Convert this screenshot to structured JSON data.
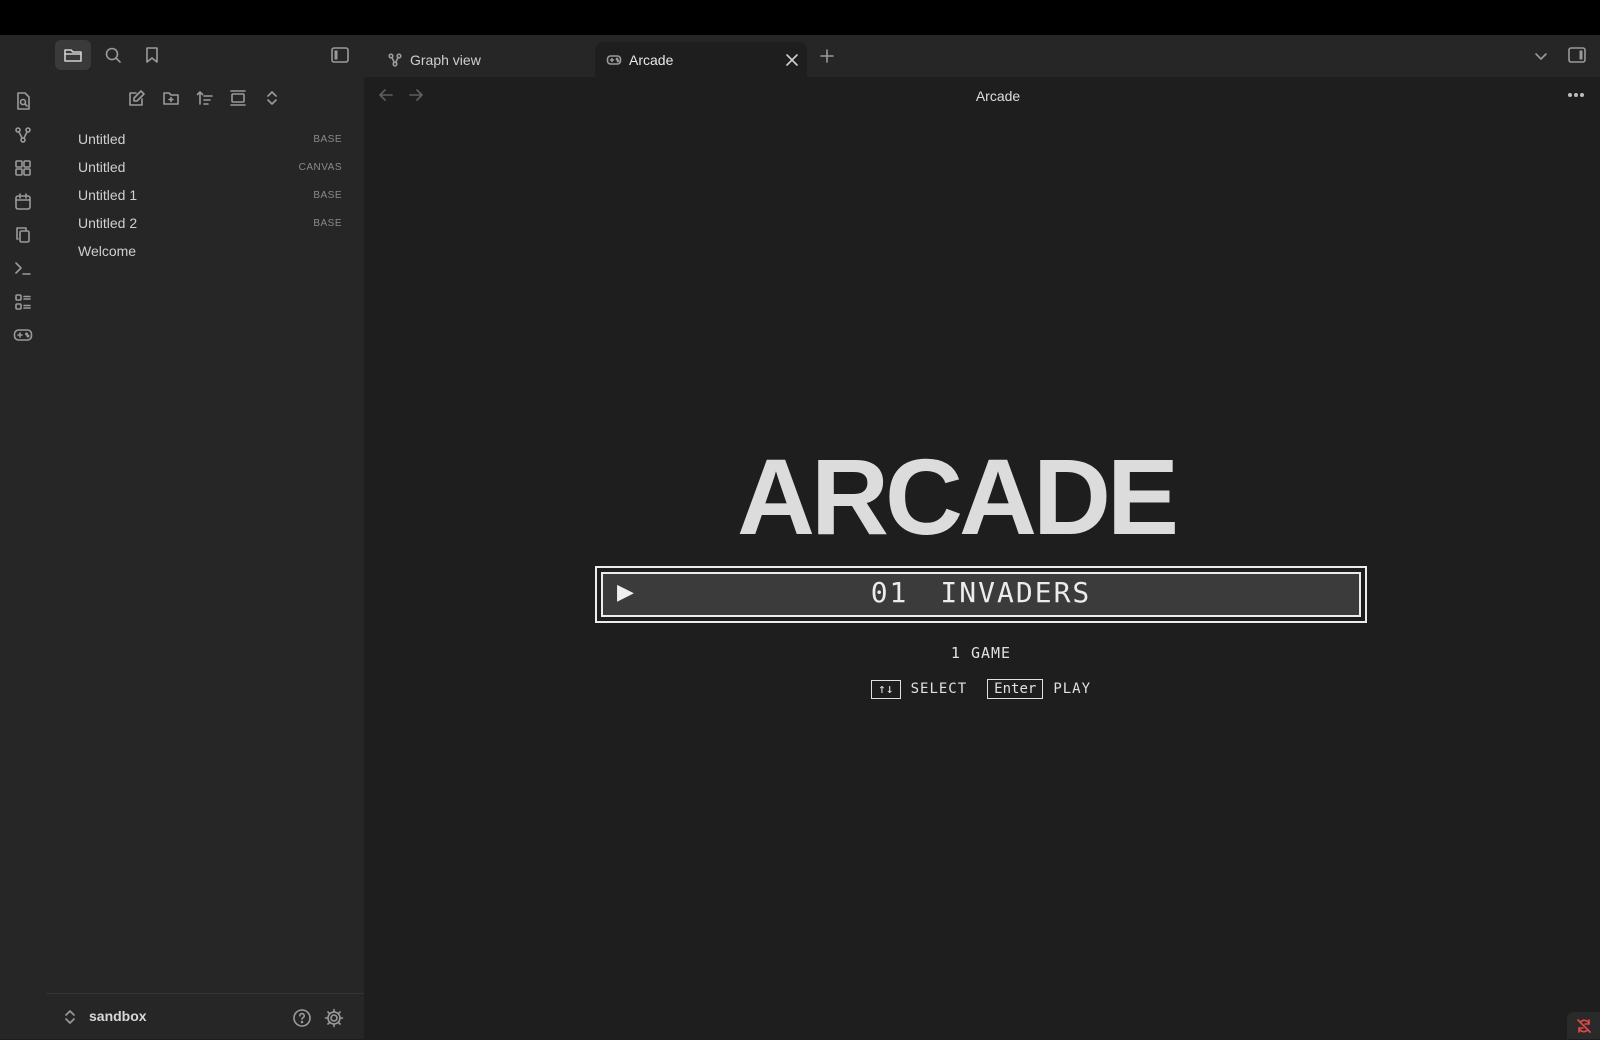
{
  "tabs": [
    {
      "label": "Graph view",
      "icon": "graph-icon",
      "active": false
    },
    {
      "label": "Arcade",
      "icon": "gamepad-icon",
      "active": true
    }
  ],
  "header": {
    "title": "Arcade"
  },
  "files": [
    {
      "name": "Untitled",
      "tag": "BASE"
    },
    {
      "name": "Untitled",
      "tag": "CANVAS"
    },
    {
      "name": "Untitled 1",
      "tag": "BASE"
    },
    {
      "name": "Untitled 2",
      "tag": "BASE"
    },
    {
      "name": "Welcome",
      "tag": ""
    }
  ],
  "vault": {
    "name": "sandbox"
  },
  "arcade": {
    "title": "ARCADE",
    "selected_marker": "▶",
    "games": [
      {
        "number": "01",
        "name": "INVADERS"
      }
    ],
    "count_label": "1 GAME",
    "hints": [
      {
        "key": "↑↓",
        "action": "SELECT"
      },
      {
        "key": "Enter",
        "action": "PLAY"
      }
    ]
  },
  "colors": {
    "accent_border": "#ececec",
    "background": "#1e1e1e",
    "panel": "#262626",
    "sync_error": "#e5484d"
  }
}
